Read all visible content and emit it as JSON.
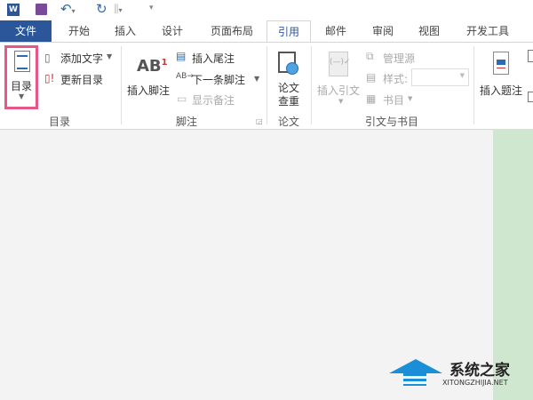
{
  "quick_access": {
    "icons": [
      "word-icon",
      "save-icon",
      "undo-icon",
      "redo-icon",
      "touch-mode-icon",
      "customize-icon"
    ]
  },
  "tabs": [
    "文件",
    "开始",
    "插入",
    "设计",
    "页面布局",
    "引用",
    "邮件",
    "审阅",
    "视图",
    "开发工具"
  ],
  "active_tab": "引用",
  "ribbon": {
    "toc": {
      "button": "目录",
      "add_text": "添加文字",
      "update": "更新目录",
      "group": "目录"
    },
    "footnotes": {
      "insert_footnote": "插入脚注",
      "insert_endnote": "插入尾注",
      "next_footnote": "下一条脚注",
      "show_notes": "显示备注",
      "group": "脚注",
      "ab": "AB",
      "sup": "1"
    },
    "paper": {
      "button_line1": "论文",
      "button_line2": "查重",
      "group": "论文"
    },
    "citations": {
      "insert_citation": "插入引文",
      "manage_sources": "管理源",
      "style_label": "样式:",
      "style_value": "",
      "bibliography": "书目",
      "group": "引文与书目"
    },
    "captions": {
      "insert_caption": "插入题注"
    }
  },
  "watermark": {
    "name": "系统之家",
    "url": "XITONGZHIJIA.NET"
  },
  "colors": {
    "file_tab": "#2b579a",
    "highlight": "#e8578a",
    "page": "#cfe6cf"
  }
}
